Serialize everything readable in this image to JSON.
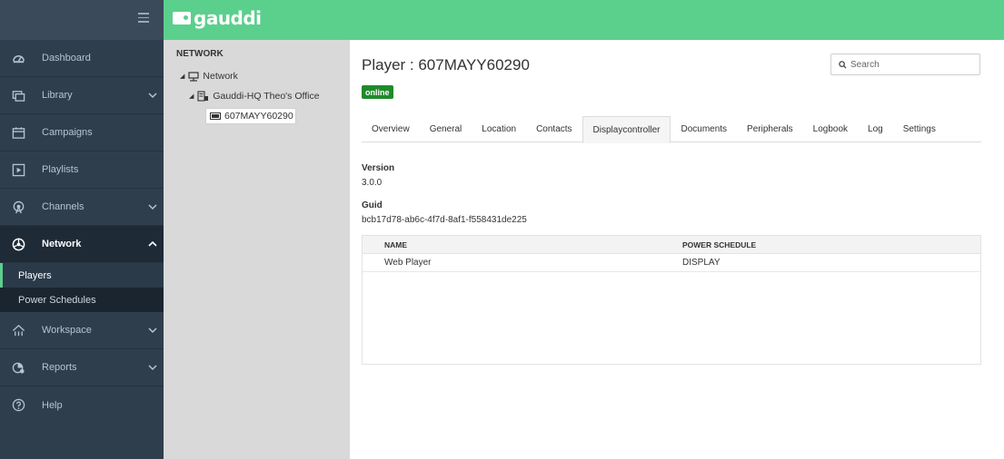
{
  "app": {
    "logo_text": "gauddi",
    "accent_color": "#5bcf8c"
  },
  "sidebar": {
    "items": [
      {
        "label": "Dashboard",
        "icon": "dashboard-icon"
      },
      {
        "label": "Library",
        "icon": "library-icon",
        "expandable": true
      },
      {
        "label": "Campaigns",
        "icon": "campaigns-icon"
      },
      {
        "label": "Playlists",
        "icon": "playlists-icon"
      },
      {
        "label": "Channels",
        "icon": "channels-icon",
        "expandable": true
      },
      {
        "label": "Network",
        "icon": "network-icon",
        "expandable": true,
        "expanded": true
      },
      {
        "label": "Workspace",
        "icon": "workspace-icon",
        "expandable": true
      },
      {
        "label": "Reports",
        "icon": "reports-icon",
        "expandable": true
      },
      {
        "label": "Help",
        "icon": "help-icon"
      }
    ],
    "network_sub": [
      {
        "label": "Players",
        "selected": true
      },
      {
        "label": "Power Schedules"
      }
    ]
  },
  "tree": {
    "title": "NETWORK",
    "root": "Network",
    "group": "Gauddi-HQ Theo's Office",
    "player": "607MAYY60290"
  },
  "main": {
    "title": "Player : 607MAYY60290",
    "status": "online",
    "search_placeholder": "Search",
    "tabs": [
      "Overview",
      "General",
      "Location",
      "Contacts",
      "Displaycontroller",
      "Documents",
      "Peripherals",
      "Logbook",
      "Log",
      "Settings"
    ],
    "active_tab": "Displaycontroller",
    "version_label": "Version",
    "version_value": "3.0.0",
    "guid_label": "Guid",
    "guid_value": "bcb17d78-ab6c-4f7d-8af1-f558431de225",
    "table": {
      "headers": [
        "NAME",
        "POWER SCHEDULE"
      ],
      "rows": [
        [
          "Web Player",
          "DISPLAY"
        ]
      ]
    }
  }
}
